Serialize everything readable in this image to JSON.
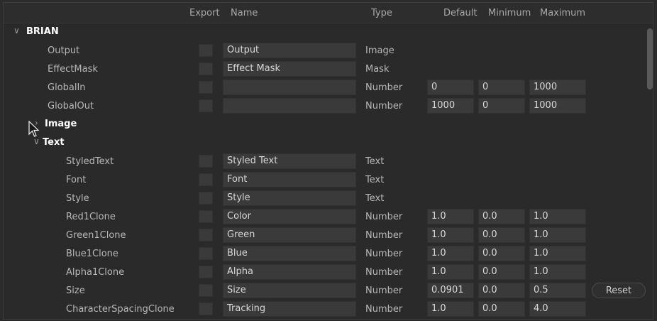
{
  "header": {
    "export": "Export",
    "name": "Name",
    "type": "Type",
    "default": "Default",
    "minimum": "Minimum",
    "maximum": "Maximum"
  },
  "group": {
    "name": "BRIAN"
  },
  "rows_top": [
    {
      "label": "Output",
      "name": "Output",
      "type": "Image"
    },
    {
      "label": "EffectMask",
      "name": "Effect Mask",
      "type": "Mask"
    },
    {
      "label": "GlobalIn",
      "name": "",
      "type": "Number",
      "default": "0",
      "minimum": "0",
      "maximum": "1000"
    },
    {
      "label": "GlobalOut",
      "name": "",
      "type": "Number",
      "default": "1000",
      "minimum": "0",
      "maximum": "1000"
    }
  ],
  "subgroups": {
    "image": "Image",
    "text": "Text"
  },
  "rows_text": [
    {
      "label": "StyledText",
      "name": "Styled Text",
      "type": "Text"
    },
    {
      "label": "Font",
      "name": "Font",
      "type": "Text"
    },
    {
      "label": "Style",
      "name": "Style",
      "type": "Text"
    },
    {
      "label": "Red1Clone",
      "name": "Color",
      "type": "Number",
      "default": "1.0",
      "minimum": "0.0",
      "maximum": "1.0"
    },
    {
      "label": "Green1Clone",
      "name": "Green",
      "type": "Number",
      "default": "1.0",
      "minimum": "0.0",
      "maximum": "1.0"
    },
    {
      "label": "Blue1Clone",
      "name": "Blue",
      "type": "Number",
      "default": "1.0",
      "minimum": "0.0",
      "maximum": "1.0"
    },
    {
      "label": "Alpha1Clone",
      "name": "Alpha",
      "type": "Number",
      "default": "1.0",
      "minimum": "0.0",
      "maximum": "1.0"
    },
    {
      "label": "Size",
      "name": "Size",
      "type": "Number",
      "default": "0.0901",
      "minimum": "0.0",
      "maximum": "0.5",
      "reset": "Reset"
    },
    {
      "label": "CharacterSpacingClone",
      "name": "Tracking",
      "type": "Number",
      "default": "1.0",
      "minimum": "0.0",
      "maximum": "4.0"
    }
  ],
  "icons": {
    "expanded": "chevron-down-icon",
    "collapsed": "chevron-right-icon",
    "cursor": "mouse-pointer-icon"
  }
}
